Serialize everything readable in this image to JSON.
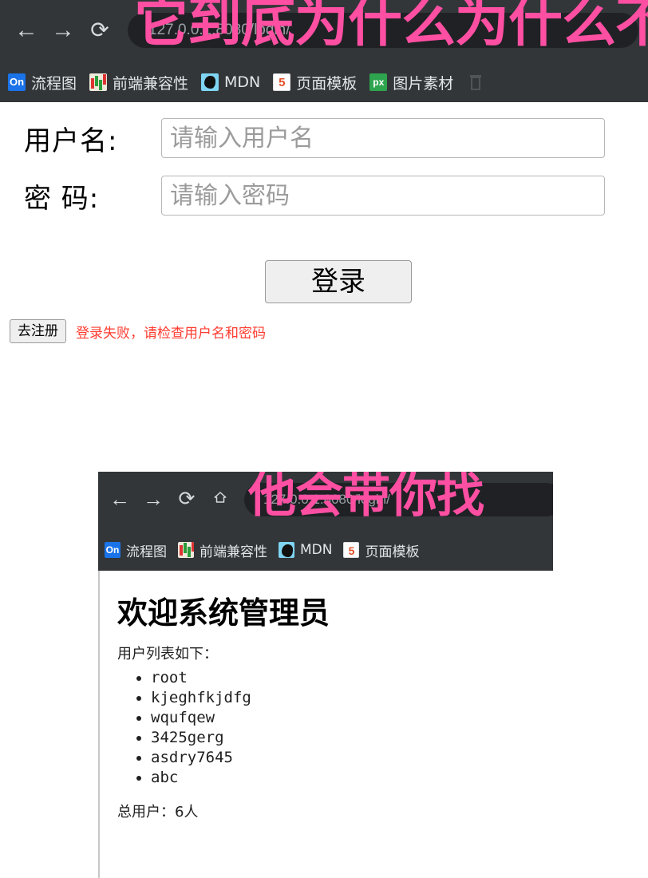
{
  "browser": {
    "nav": {
      "back_icon": "arrow-left-icon",
      "forward_icon": "arrow-right-icon",
      "reload_icon": "reload-icon",
      "home_icon": "home-icon",
      "back_glyph": "←",
      "forward_glyph": "→",
      "reload_glyph": "⟳",
      "home_glyph": "⌂"
    },
    "url": "127.0.0.1:8080/login/",
    "annotation_overlay": "它到底为什么为什么不",
    "annotation_color": "#ff4fa3",
    "bookmarks": [
      {
        "label": "流程图",
        "favicon": "on-favicon",
        "favicon_text": "On"
      },
      {
        "label": "前端兼容性",
        "favicon": "chart-favicon",
        "favicon_text": ""
      },
      {
        "label": "MDN",
        "favicon": "mdn-favicon",
        "favicon_text": ""
      },
      {
        "label": "页面模板",
        "favicon": "html5-favicon",
        "favicon_text": "5"
      },
      {
        "label": "图片素材",
        "favicon": "px-favicon",
        "favicon_text": "px"
      }
    ]
  },
  "login_page": {
    "username": {
      "label": "用户名:",
      "placeholder": "请输入用户名",
      "value": ""
    },
    "password": {
      "label": "密 码:",
      "placeholder": "请输入密码",
      "value": ""
    },
    "login_button": "登录",
    "register_button": "去注册",
    "error_message": "登录失败，请检查用户名和密码",
    "error_color": "#ff3b30"
  },
  "inner_window": {
    "url": "127.0.0.1:8080/login/",
    "annotation_overlay": "他会带你找",
    "bookmarks": [
      {
        "label": "流程图",
        "favicon": "on-favicon",
        "favicon_text": "On"
      },
      {
        "label": "前端兼容性",
        "favicon": "chart-favicon",
        "favicon_text": ""
      },
      {
        "label": "MDN",
        "favicon": "mdn-favicon",
        "favicon_text": ""
      },
      {
        "label": "页面模板",
        "favicon": "html5-favicon",
        "favicon_text": "5"
      }
    ],
    "heading": "欢迎系统管理员",
    "subtitle": "用户列表如下：",
    "users": [
      "root",
      "kjeghfkjdfg",
      "wqufqew",
      "3425gerg",
      "asdry7645",
      "abc"
    ],
    "total_label": "总用户：6人"
  }
}
